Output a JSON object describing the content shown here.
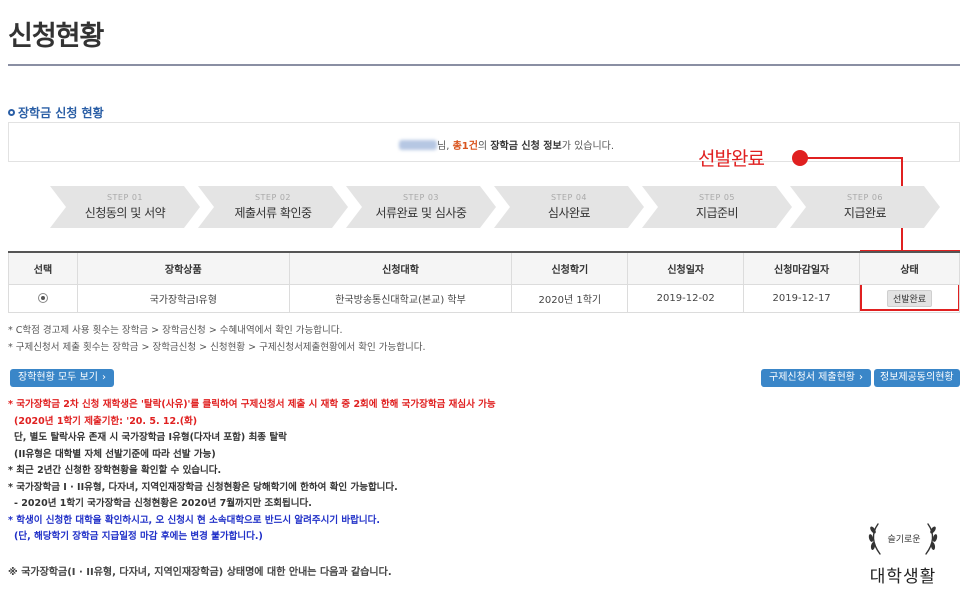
{
  "page": {
    "title": "신청현황"
  },
  "section": {
    "title": "장학금 신청 현황"
  },
  "info": {
    "suffix_nim": "님, ",
    "count": "총1건",
    "mid": "의 ",
    "strong": "장학금 신청 정보",
    "end": "가 있습니다."
  },
  "annotation": {
    "label": "선발완료",
    "color": "#e02020"
  },
  "steps": [
    {
      "num": "STEP 01",
      "label": "신청동의 및 서약"
    },
    {
      "num": "STEP 02",
      "label": "제출서류 확인중"
    },
    {
      "num": "STEP 03",
      "label": "서류완료 및 심사중"
    },
    {
      "num": "STEP 04",
      "label": "심사완료"
    },
    {
      "num": "STEP 05",
      "label": "지급준비"
    },
    {
      "num": "STEP 06",
      "label": "지급완료"
    }
  ],
  "table": {
    "headers": [
      "선택",
      "장학상품",
      "신청대학",
      "신청학기",
      "신청일자",
      "신청마감일자",
      "상태"
    ],
    "row": {
      "product": "국가장학금I유형",
      "university": "한국방송통신대학교(본교) 학부",
      "semester": "2020년 1학기",
      "apply_date": "2019-12-02",
      "deadline": "2019-12-17",
      "status": "선발완료"
    }
  },
  "notes": [
    "* C학점 경고제 사용 횟수는 장학금 > 장학금신청 > 수혜내역에서 확인 가능합니다.",
    "* 구제신청서 제출 횟수는 장학금 > 장학금신청 > 신청현황 > 구제신청서제출현황에서 확인 가능합니다."
  ],
  "buttons": {
    "view_all": "장학현황 모두 보기",
    "relief_status": "구제신청서 제출현황",
    "info_consent": "정보제공동의현황"
  },
  "guide": {
    "line1": "* 국가장학금 2차 신청 재학생은 '탈락(사유)'를 클릭하여 구제신청서 제출 시 재학 중 2회에 한해 국가장학금 재심사 가능",
    "line2": "(2020년 1학기 제출기한: '20. 5. 12.(화)",
    "line3": "단, 별도 탈락사유 존재 시 국가장학금 I유형(다자녀 포함) 최종 탈락",
    "line4": "(II유형은 대학별 자체 선발기준에 따라 선발 가능)",
    "line5": "* 최근 2년간 신청한 장학현황을 확인할 수 있습니다.",
    "line6": "* 국가장학금 I · II유형, 다자녀, 지역인재장학금 신청현황은 당해학기에 한하여 확인 가능합니다.",
    "line7": "- 2020년 1학기 국가장학금 신청현황은 2020년 7월까지만 조회됩니다.",
    "line8": "* 학생이 신청한 대학을 확인하시고, 오 신청시 현 소속대학으로 반드시 알려주시기 바랍니다.",
    "line9": "(단, 해당학기 장학금 지급일정 마감 후에는 변경 불가합니다.)"
  },
  "footnote": "※ 국가장학금(I · II유형, 다자녀, 지역인재장학금) 상태명에 대한 안내는 다음과 같습니다.",
  "watermark": {
    "small": "슬기로운",
    "big": "대학생활"
  }
}
